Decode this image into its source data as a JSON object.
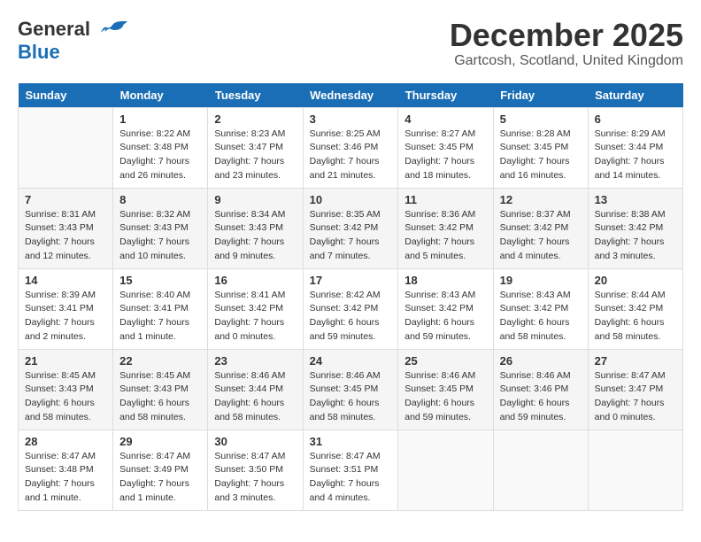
{
  "header": {
    "logo_general": "General",
    "logo_blue": "Blue",
    "month_title": "December 2025",
    "location": "Gartcosh, Scotland, United Kingdom"
  },
  "days_of_week": [
    "Sunday",
    "Monday",
    "Tuesday",
    "Wednesday",
    "Thursday",
    "Friday",
    "Saturday"
  ],
  "weeks": [
    [
      {
        "day": "",
        "info": ""
      },
      {
        "day": "1",
        "info": "Sunrise: 8:22 AM\nSunset: 3:48 PM\nDaylight: 7 hours\nand 26 minutes."
      },
      {
        "day": "2",
        "info": "Sunrise: 8:23 AM\nSunset: 3:47 PM\nDaylight: 7 hours\nand 23 minutes."
      },
      {
        "day": "3",
        "info": "Sunrise: 8:25 AM\nSunset: 3:46 PM\nDaylight: 7 hours\nand 21 minutes."
      },
      {
        "day": "4",
        "info": "Sunrise: 8:27 AM\nSunset: 3:45 PM\nDaylight: 7 hours\nand 18 minutes."
      },
      {
        "day": "5",
        "info": "Sunrise: 8:28 AM\nSunset: 3:45 PM\nDaylight: 7 hours\nand 16 minutes."
      },
      {
        "day": "6",
        "info": "Sunrise: 8:29 AM\nSunset: 3:44 PM\nDaylight: 7 hours\nand 14 minutes."
      }
    ],
    [
      {
        "day": "7",
        "info": "Sunrise: 8:31 AM\nSunset: 3:43 PM\nDaylight: 7 hours\nand 12 minutes."
      },
      {
        "day": "8",
        "info": "Sunrise: 8:32 AM\nSunset: 3:43 PM\nDaylight: 7 hours\nand 10 minutes."
      },
      {
        "day": "9",
        "info": "Sunrise: 8:34 AM\nSunset: 3:43 PM\nDaylight: 7 hours\nand 9 minutes."
      },
      {
        "day": "10",
        "info": "Sunrise: 8:35 AM\nSunset: 3:42 PM\nDaylight: 7 hours\nand 7 minutes."
      },
      {
        "day": "11",
        "info": "Sunrise: 8:36 AM\nSunset: 3:42 PM\nDaylight: 7 hours\nand 5 minutes."
      },
      {
        "day": "12",
        "info": "Sunrise: 8:37 AM\nSunset: 3:42 PM\nDaylight: 7 hours\nand 4 minutes."
      },
      {
        "day": "13",
        "info": "Sunrise: 8:38 AM\nSunset: 3:42 PM\nDaylight: 7 hours\nand 3 minutes."
      }
    ],
    [
      {
        "day": "14",
        "info": "Sunrise: 8:39 AM\nSunset: 3:41 PM\nDaylight: 7 hours\nand 2 minutes."
      },
      {
        "day": "15",
        "info": "Sunrise: 8:40 AM\nSunset: 3:41 PM\nDaylight: 7 hours\nand 1 minute."
      },
      {
        "day": "16",
        "info": "Sunrise: 8:41 AM\nSunset: 3:42 PM\nDaylight: 7 hours\nand 0 minutes."
      },
      {
        "day": "17",
        "info": "Sunrise: 8:42 AM\nSunset: 3:42 PM\nDaylight: 6 hours\nand 59 minutes."
      },
      {
        "day": "18",
        "info": "Sunrise: 8:43 AM\nSunset: 3:42 PM\nDaylight: 6 hours\nand 59 minutes."
      },
      {
        "day": "19",
        "info": "Sunrise: 8:43 AM\nSunset: 3:42 PM\nDaylight: 6 hours\nand 58 minutes."
      },
      {
        "day": "20",
        "info": "Sunrise: 8:44 AM\nSunset: 3:42 PM\nDaylight: 6 hours\nand 58 minutes."
      }
    ],
    [
      {
        "day": "21",
        "info": "Sunrise: 8:45 AM\nSunset: 3:43 PM\nDaylight: 6 hours\nand 58 minutes."
      },
      {
        "day": "22",
        "info": "Sunrise: 8:45 AM\nSunset: 3:43 PM\nDaylight: 6 hours\nand 58 minutes."
      },
      {
        "day": "23",
        "info": "Sunrise: 8:46 AM\nSunset: 3:44 PM\nDaylight: 6 hours\nand 58 minutes."
      },
      {
        "day": "24",
        "info": "Sunrise: 8:46 AM\nSunset: 3:45 PM\nDaylight: 6 hours\nand 58 minutes."
      },
      {
        "day": "25",
        "info": "Sunrise: 8:46 AM\nSunset: 3:45 PM\nDaylight: 6 hours\nand 59 minutes."
      },
      {
        "day": "26",
        "info": "Sunrise: 8:46 AM\nSunset: 3:46 PM\nDaylight: 6 hours\nand 59 minutes."
      },
      {
        "day": "27",
        "info": "Sunrise: 8:47 AM\nSunset: 3:47 PM\nDaylight: 7 hours\nand 0 minutes."
      }
    ],
    [
      {
        "day": "28",
        "info": "Sunrise: 8:47 AM\nSunset: 3:48 PM\nDaylight: 7 hours\nand 1 minute."
      },
      {
        "day": "29",
        "info": "Sunrise: 8:47 AM\nSunset: 3:49 PM\nDaylight: 7 hours\nand 1 minute."
      },
      {
        "day": "30",
        "info": "Sunrise: 8:47 AM\nSunset: 3:50 PM\nDaylight: 7 hours\nand 3 minutes."
      },
      {
        "day": "31",
        "info": "Sunrise: 8:47 AM\nSunset: 3:51 PM\nDaylight: 7 hours\nand 4 minutes."
      },
      {
        "day": "",
        "info": ""
      },
      {
        "day": "",
        "info": ""
      },
      {
        "day": "",
        "info": ""
      }
    ]
  ]
}
